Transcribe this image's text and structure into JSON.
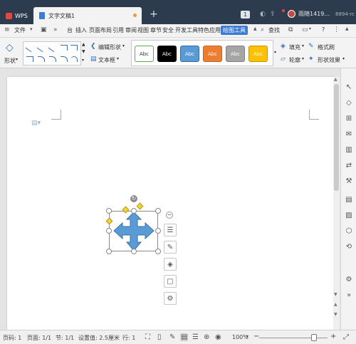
{
  "titlebar": {
    "app_name": "WPS",
    "doc_tab": "文字文稿1",
    "new_tab": "+",
    "badge": "1",
    "user_name": "雨随1419...",
    "extra": "8894-rc"
  },
  "menubar": {
    "file": "文件",
    "items": [
      "插入",
      "页面布局",
      "引用",
      "审阅",
      "视图",
      "章节",
      "安全",
      "开发工具",
      "特色应用",
      "绘图工具"
    ],
    "active": "绘图工具",
    "search": "查找",
    "more": "»",
    "prefix": "台",
    "help": "?"
  },
  "ribbon": {
    "shape_label": "形状",
    "edit_shape": "编辑形状",
    "text_box": "文本框",
    "swatches": [
      {
        "label": "Abc",
        "bg": "#ffffff",
        "fg": "#333333",
        "border": "#6aa84f"
      },
      {
        "label": "Abc",
        "bg": "#000000",
        "fg": "#ffffff",
        "border": "#000000"
      },
      {
        "label": "Abc",
        "bg": "#5b9bd5",
        "fg": "#ffffff",
        "border": "#2e6da4"
      },
      {
        "label": "Abc",
        "bg": "#ed7d31",
        "fg": "#ffffff",
        "border": "#c4621f"
      },
      {
        "label": "Abc",
        "bg": "#a5a5a5",
        "fg": "#ffffff",
        "border": "#808080"
      },
      {
        "label": "Abc",
        "bg": "#ffc000",
        "fg": "#ffffff",
        "border": "#c79500"
      }
    ],
    "fill": "填充",
    "outline": "轮廓",
    "format_brush": "格式刷",
    "shape_effect": "形状效果"
  },
  "statusbar": {
    "page_num": "页码: 1",
    "pages": "页面: 1/1",
    "section": "节: 1/1",
    "setting": "设置值: 2.5厘米",
    "row": "行: 1",
    "zoom": "100%",
    "minus": "−",
    "plus": "+"
  },
  "colors": {
    "accent": "#3b7bd4",
    "shape_fill": "#5b9bd5"
  }
}
